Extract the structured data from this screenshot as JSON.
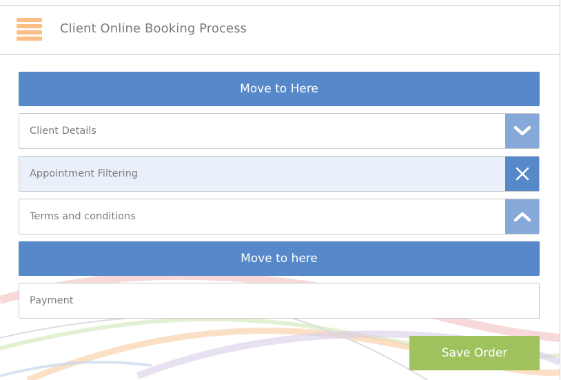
{
  "header": {
    "title": "Client Online Booking Process",
    "menu_icon": "hamburger-menu-icon",
    "menu_color": "#fbbf86"
  },
  "steps": {
    "move_top_label": "Move to Here",
    "client_details": {
      "label": "Client Details",
      "icon": "chevron-down-icon"
    },
    "appointment_filtering": {
      "label": "Appointment Filtering",
      "icon": "close-icon"
    },
    "terms": {
      "label": "Terms and conditions",
      "icon": "chevron-up-icon"
    },
    "move_bottom_label": "Move to here",
    "payment": {
      "label": "Payment"
    }
  },
  "footer": {
    "save_label": "Save Order"
  },
  "colors": {
    "primary_blue": "#5788c9",
    "light_blue": "#87a9d9",
    "active_row": "#eaf0f9",
    "save_green": "#9fc25e"
  }
}
